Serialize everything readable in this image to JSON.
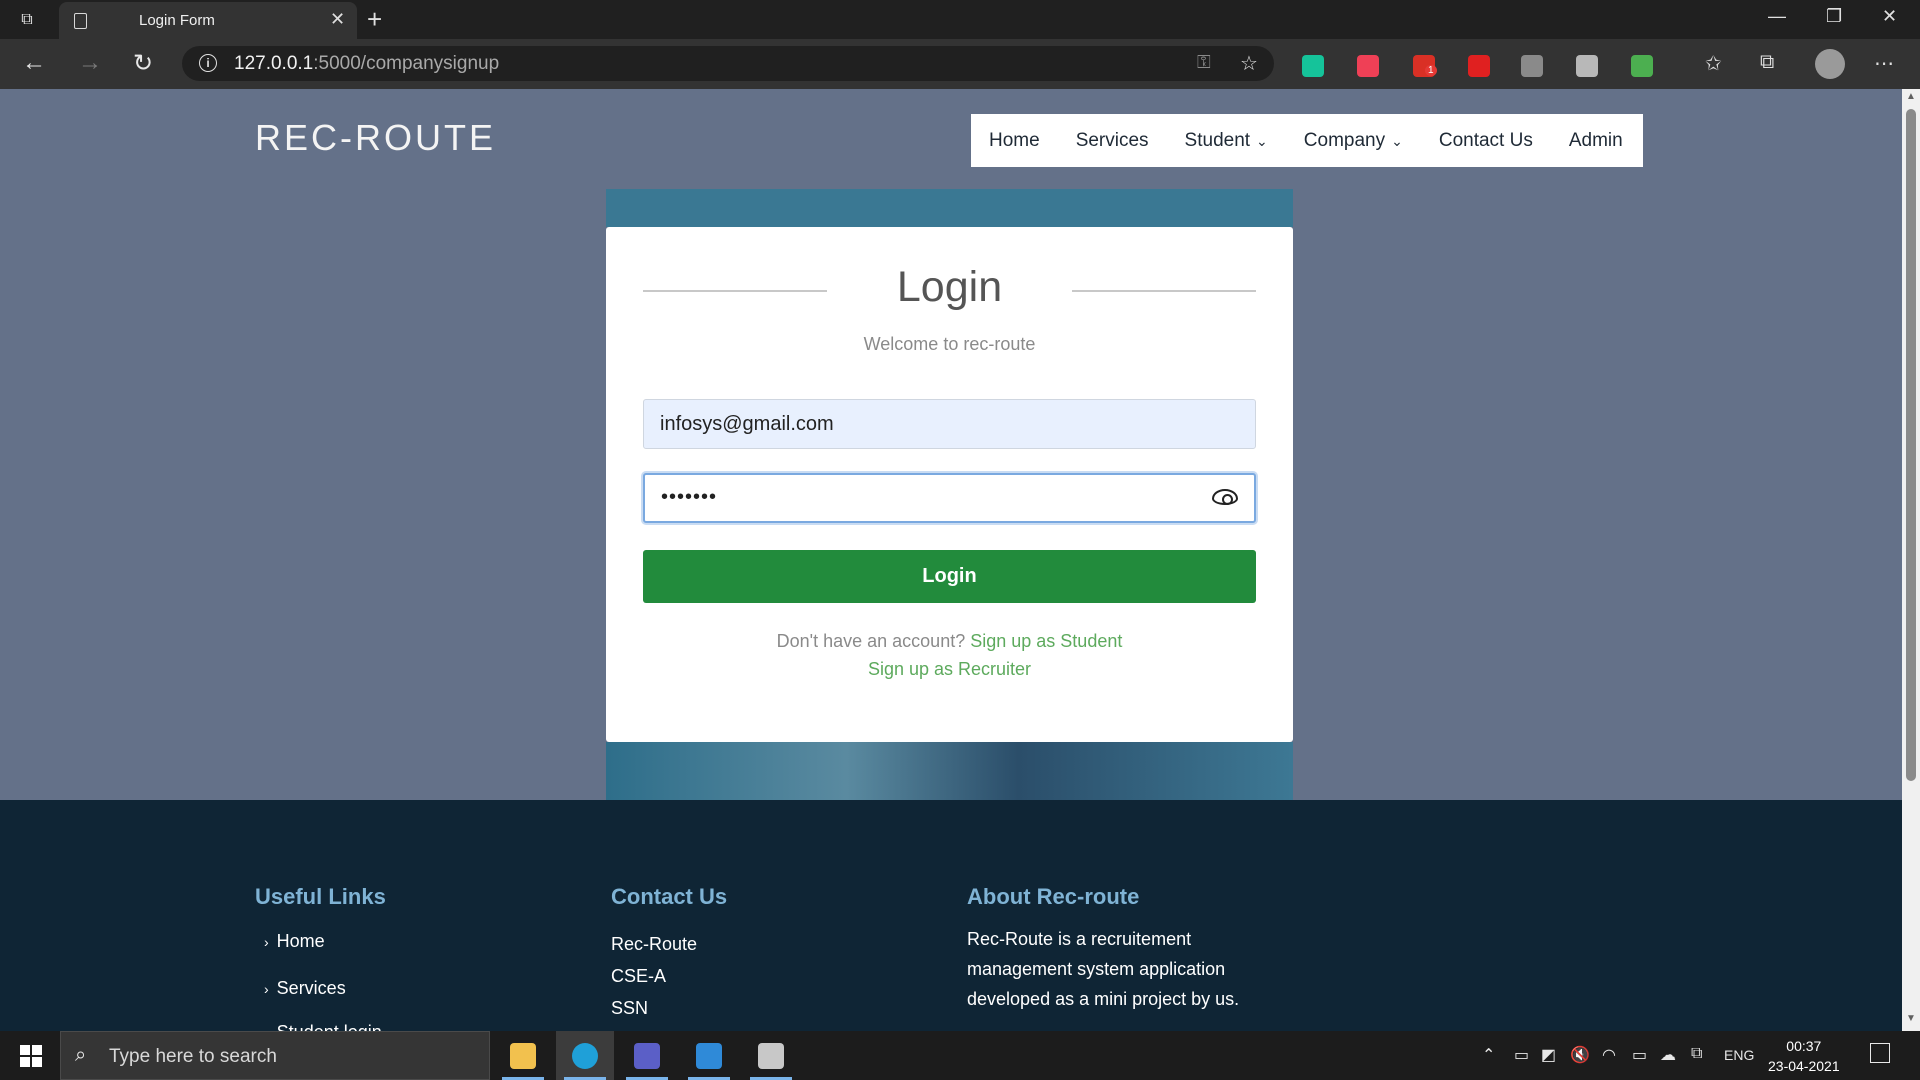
{
  "browser": {
    "tab_title": "Login Form",
    "new_tab": "+",
    "url_host": "127.0.0.1",
    "url_rest": ":5000/companysignup",
    "extensions": [
      {
        "name": "grammarly-icon",
        "color": "#15c39a"
      },
      {
        "name": "pocket-icon",
        "color": "#ef4056"
      },
      {
        "name": "todo-extension-icon",
        "color": "#d93025"
      },
      {
        "name": "red-pen-icon",
        "color": "#e02020"
      },
      {
        "name": "copy-extension-icon",
        "color": "#8a8a8a"
      },
      {
        "name": "hand-extension-icon",
        "color": "#b8b8b8"
      },
      {
        "name": "mail-extension-icon",
        "color": "#4caf50"
      }
    ],
    "extension_badge": "1"
  },
  "site": {
    "brand": "REC-ROUTE",
    "nav": [
      {
        "label": "Home"
      },
      {
        "label": "Services"
      },
      {
        "label": "Student",
        "dropdown": true
      },
      {
        "label": "Company",
        "dropdown": true
      },
      {
        "label": "Contact Us"
      },
      {
        "label": "Admin"
      }
    ]
  },
  "login": {
    "title": "Login",
    "subtitle": "Welcome to rec-route",
    "email_value": "infosys@gmail.com",
    "password_mask": "•••••••",
    "button": "Login",
    "no_account": "Don't have an account?",
    "signup_student": "Sign up as Student",
    "signup_recruiter": "Sign up as Recruiter"
  },
  "footer": {
    "useful_links_title": "Useful Links",
    "useful_links": [
      "Home",
      "Services",
      "Student login"
    ],
    "contact_title": "Contact Us",
    "contact_lines": [
      "Rec-Route",
      "CSE-A",
      "SSN"
    ],
    "about_title": "About Rec-route",
    "about_lines": [
      "Rec-Route is a recruitement",
      "management system application",
      "developed as a mini project by us."
    ]
  },
  "taskbar": {
    "search_placeholder": "Type here to search",
    "language": "ENG",
    "time": "00:37",
    "date": "23-04-2021",
    "apps": [
      {
        "name": "file-explorer-icon",
        "color": "#f2c14e",
        "active": false
      },
      {
        "name": "edge-icon",
        "color": "#1fa0d8",
        "active": true
      },
      {
        "name": "teams-icon",
        "color": "#5b5fc7",
        "active": false
      },
      {
        "name": "vscode-icon",
        "color": "#2f8ad8",
        "active": false
      },
      {
        "name": "database-icon",
        "color": "#c8c8c8",
        "active": false
      }
    ]
  }
}
